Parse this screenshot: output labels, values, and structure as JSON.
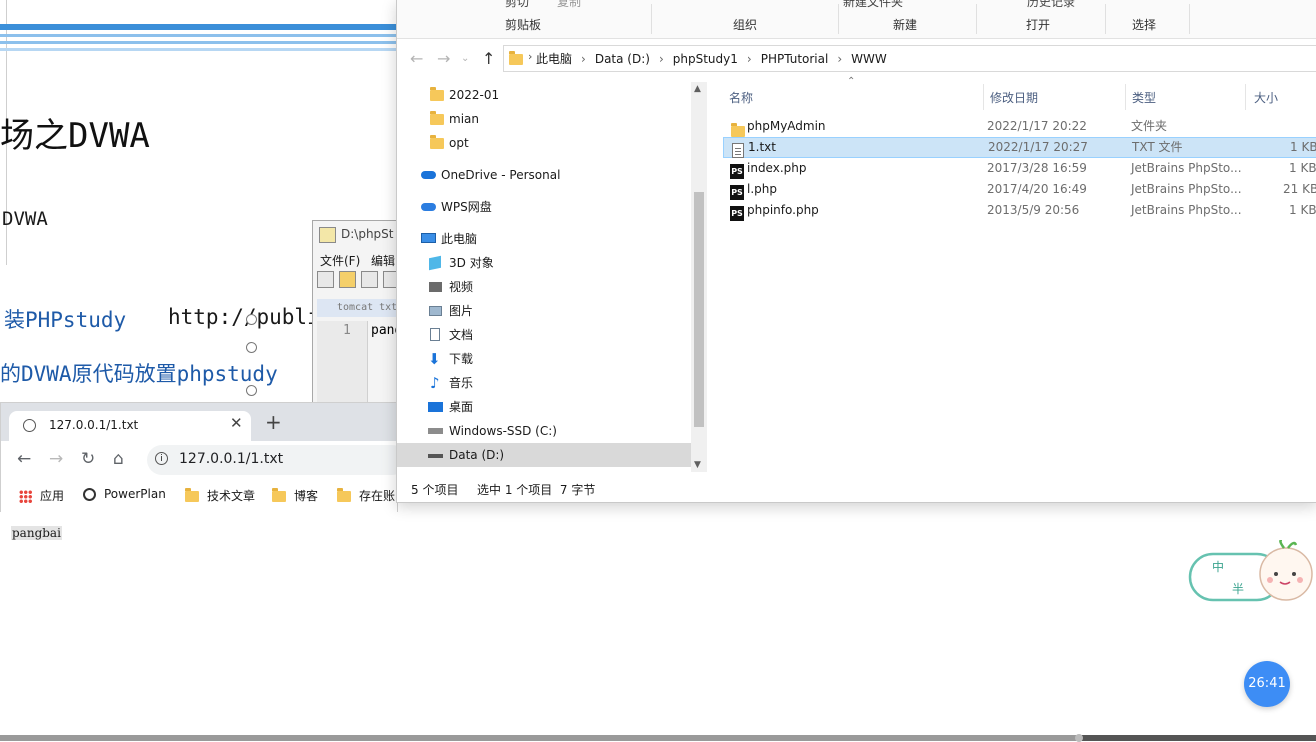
{
  "document": {
    "title": "场之DVWA",
    "subtitle": "DVWA",
    "step1": "装PHPstudy",
    "step1_url": "http://publi",
    "step2": "的DVWA原代码放置phpstudy"
  },
  "notepad": {
    "title": "D:\\phpSt",
    "menu_file": "文件(F)",
    "menu_edit": "编辑",
    "tab_label": "tomcat txt",
    "line_number": "1",
    "code": "pang"
  },
  "explorer": {
    "ribbon_top": [
      "剪切",
      "复制",
      "新建文件夹",
      "历史记录"
    ],
    "ribbon_groups": [
      "剪贴板",
      "组织",
      "新建",
      "打开",
      "选择"
    ],
    "breadcrumb": [
      "此电脑",
      "Data (D:)",
      "phpStudy1",
      "PHPTutorial",
      "WWW"
    ],
    "nav_items": [
      {
        "label": "2022-01",
        "icon": "folder-icon"
      },
      {
        "label": "mian",
        "icon": "folder-icon"
      },
      {
        "label": "opt",
        "icon": "folder-icon"
      },
      {
        "label": "OneDrive - Personal",
        "icon": "cloud-icon"
      },
      {
        "label": "WPS网盘",
        "icon": "cloud-icon"
      },
      {
        "label": "此电脑",
        "icon": "computer-icon"
      },
      {
        "label": "3D 对象",
        "icon": "cube-icon"
      },
      {
        "label": "视频",
        "icon": "video-icon"
      },
      {
        "label": "图片",
        "icon": "picture-icon"
      },
      {
        "label": "文档",
        "icon": "document-icon"
      },
      {
        "label": "下载",
        "icon": "download-icon"
      },
      {
        "label": "音乐",
        "icon": "music-icon"
      },
      {
        "label": "桌面",
        "icon": "desktop-icon"
      },
      {
        "label": "Windows-SSD (C:)",
        "icon": "drive-icon"
      },
      {
        "label": "Data (D:)",
        "icon": "drive-icon"
      }
    ],
    "columns": [
      "名称",
      "修改日期",
      "类型",
      "大小"
    ],
    "files": [
      {
        "name": "phpMyAdmin",
        "date": "2022/1/17 20:22",
        "type": "文件夹",
        "size": "",
        "icon": "folder-icon"
      },
      {
        "name": "1.txt",
        "date": "2022/1/17 20:27",
        "type": "TXT 文件",
        "size": "1 KB",
        "icon": "text-file-icon"
      },
      {
        "name": "index.php",
        "date": "2017/3/28 16:59",
        "type": "JetBrains PhpSto...",
        "size": "1 KB",
        "icon": "phpstorm-icon"
      },
      {
        "name": "l.php",
        "date": "2017/4/20 16:49",
        "type": "JetBrains PhpSto...",
        "size": "21 KB",
        "icon": "phpstorm-icon"
      },
      {
        "name": "phpinfo.php",
        "date": "2013/5/9 20:56",
        "type": "JetBrains PhpSto...",
        "size": "1 KB",
        "icon": "phpstorm-icon"
      }
    ],
    "status_count": "5 个项目",
    "status_selected": "选中 1 个项目  7 字节"
  },
  "browser": {
    "tab_title": "127.0.0.1/1.txt",
    "url": "127.0.0.1/1.txt",
    "bookmarks": [
      "应用",
      "PowerPlan",
      "技术文章",
      "博客",
      "存在账"
    ],
    "page_text": "pangbai"
  },
  "overlay": {
    "timer": "26:41",
    "mascot_text_1": "中",
    "mascot_text_2": "半",
    "progress_percent": 82
  }
}
